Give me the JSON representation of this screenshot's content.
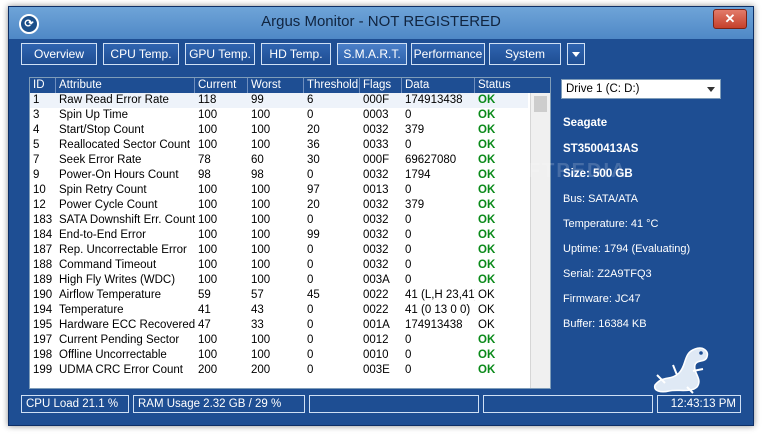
{
  "window": {
    "title": "Argus Monitor - NOT REGISTERED",
    "close_glyph": "✕"
  },
  "tabs": [
    {
      "label": "Overview"
    },
    {
      "label": "CPU Temp."
    },
    {
      "label": "GPU Temp."
    },
    {
      "label": "HD Temp."
    },
    {
      "label": "S.M.A.R.T."
    },
    {
      "label": "Performance"
    },
    {
      "label": "System"
    }
  ],
  "table": {
    "columns": [
      "ID",
      "Attribute",
      "Current",
      "Worst",
      "Threshold",
      "Flags",
      "Data",
      "Status"
    ],
    "rows": [
      [
        "1",
        "Raw Read Error Rate",
        "118",
        "99",
        "6",
        "000F",
        "174913438",
        "OK"
      ],
      [
        "3",
        "Spin Up Time",
        "100",
        "100",
        "0",
        "0003",
        "0",
        "OK"
      ],
      [
        "4",
        "Start/Stop Count",
        "100",
        "100",
        "20",
        "0032",
        "379",
        "OK"
      ],
      [
        "5",
        "Reallocated Sector Count",
        "100",
        "100",
        "36",
        "0033",
        "0",
        "OK"
      ],
      [
        "7",
        "Seek Error Rate",
        "78",
        "60",
        "30",
        "000F",
        "69627080",
        "OK"
      ],
      [
        "9",
        "Power-On Hours Count",
        "98",
        "98",
        "0",
        "0032",
        "1794",
        "OK"
      ],
      [
        "10",
        "Spin Retry Count",
        "100",
        "100",
        "97",
        "0013",
        "0",
        "OK"
      ],
      [
        "12",
        "Power Cycle Count",
        "100",
        "100",
        "20",
        "0032",
        "379",
        "OK"
      ],
      [
        "183",
        "SATA Downshift Err. Count",
        "100",
        "100",
        "0",
        "0032",
        "0",
        "OK"
      ],
      [
        "184",
        "End-to-End Error",
        "100",
        "100",
        "99",
        "0032",
        "0",
        "OK"
      ],
      [
        "187",
        "Rep. Uncorrectable Error",
        "100",
        "100",
        "0",
        "0032",
        "0",
        "OK"
      ],
      [
        "188",
        "Command Timeout",
        "100",
        "100",
        "0",
        "0032",
        "0",
        "OK"
      ],
      [
        "189",
        "High Fly Writes (WDC)",
        "100",
        "100",
        "0",
        "003A",
        "0",
        "OK"
      ],
      [
        "190",
        "Airflow Temperature",
        "59",
        "57",
        "45",
        "0022",
        "41 (L,H 23,41)",
        "OK"
      ],
      [
        "194",
        "Temperature",
        "41",
        "43",
        "0",
        "0022",
        "41 (0 13 0 0)",
        "OK"
      ],
      [
        "195",
        "Hardware ECC Recovered",
        "47",
        "33",
        "0",
        "001A",
        "174913438",
        "OK"
      ],
      [
        "197",
        "Current Pending Sector",
        "100",
        "100",
        "0",
        "0012",
        "0",
        "OK"
      ],
      [
        "198",
        "Offline Uncorrectable",
        "100",
        "100",
        "0",
        "0010",
        "0",
        "OK"
      ],
      [
        "199",
        "UDMA CRC Error Count",
        "200",
        "200",
        "0",
        "003E",
        "0",
        "OK"
      ]
    ],
    "green_status_rows": [
      0,
      1,
      2,
      3,
      4,
      5,
      6,
      7,
      8,
      9,
      10,
      11,
      12,
      16,
      17,
      18
    ]
  },
  "drive": {
    "selected": "Drive 1 (C: D:)",
    "vendor": "Seagate",
    "model": "ST3500413AS",
    "size": "Size: 500 GB",
    "bus": "Bus: SATA/ATA",
    "temperature": "Temperature: 41 °C",
    "uptime": "Uptime: 1794 (Evaluating)",
    "serial": "Serial: Z2A9TFQ3",
    "firmware": "Firmware: JC47",
    "buffer": "Buffer: 16384 KB"
  },
  "watermark": "SOFTPEDIA",
  "status": {
    "cpu_load": "CPU Load 21.1 %",
    "ram_usage": "RAM Usage 2.32 GB / 29 %",
    "time": "12:43:13 PM"
  },
  "colors": {
    "window_bg": "#1e4e93",
    "ok_green": "#0a8a1a"
  }
}
